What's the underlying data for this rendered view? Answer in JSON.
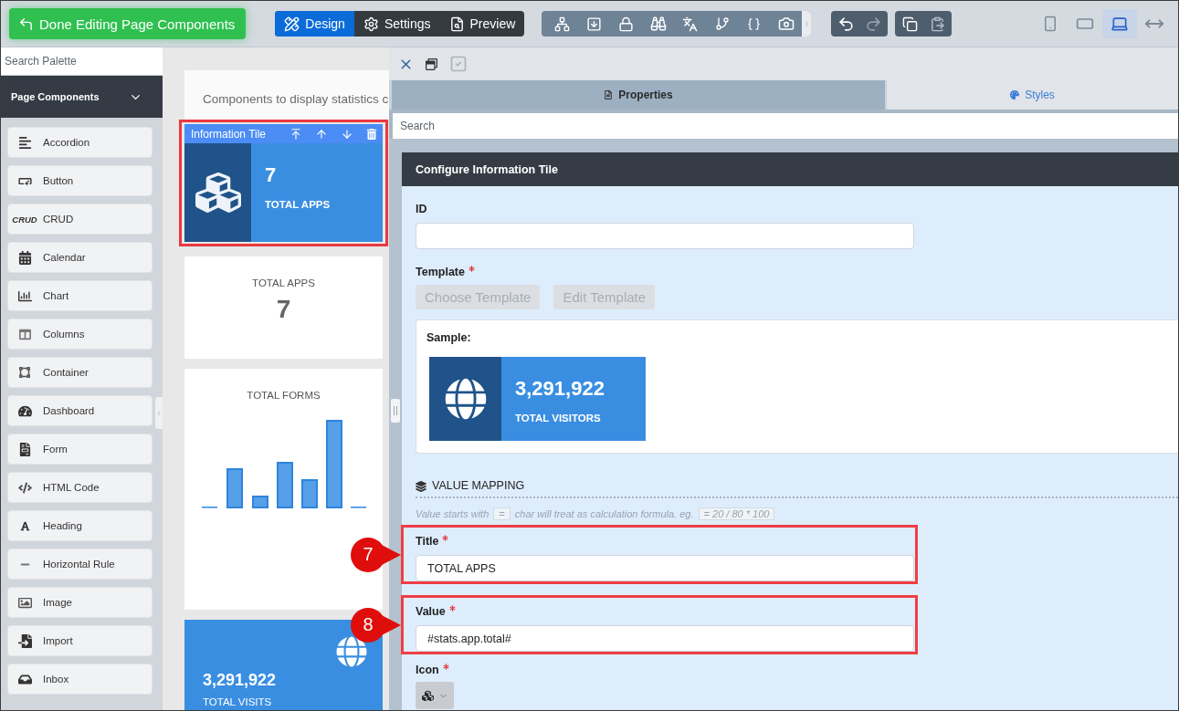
{
  "toolbar": {
    "done_button": "Done Editing Page Components",
    "modes": [
      {
        "kind": "design",
        "label": "Design",
        "selected": true
      },
      {
        "kind": "settings",
        "label": "Settings",
        "selected": false
      },
      {
        "kind": "preview",
        "label": "Preview",
        "selected": false
      }
    ],
    "undo": {
      "disabled": false
    },
    "redo": {
      "disabled": true
    },
    "devices": [
      {
        "kind": "phone",
        "selected": false
      },
      {
        "kind": "tablet",
        "selected": false
      },
      {
        "kind": "laptop",
        "selected": true
      },
      {
        "kind": "full-width",
        "selected": false
      }
    ]
  },
  "palette": {
    "search_placeholder": "Search Palette",
    "section": {
      "title": "Page Components",
      "expanded": true
    },
    "items": [
      {
        "kind": "accordion",
        "label": "Accordion"
      },
      {
        "kind": "button",
        "label": "Button"
      },
      {
        "kind": "crud",
        "badge": "CRUD",
        "label": "CRUD"
      },
      {
        "kind": "calendar",
        "label": "Calendar"
      },
      {
        "kind": "chart",
        "label": "Chart"
      },
      {
        "kind": "columns",
        "label": "Columns"
      },
      {
        "kind": "container",
        "label": "Container"
      },
      {
        "kind": "dashboard",
        "label": "Dashboard"
      },
      {
        "kind": "form",
        "label": "Form"
      },
      {
        "kind": "html",
        "label": "HTML Code"
      },
      {
        "kind": "heading",
        "label": "Heading"
      },
      {
        "kind": "rule",
        "label": "Horizontal Rule"
      },
      {
        "kind": "image",
        "label": "Image"
      },
      {
        "kind": "import",
        "label": "Import"
      },
      {
        "kind": "inbox",
        "label": "Inbox"
      }
    ]
  },
  "canvas": {
    "description": "Components to display statistics c",
    "tiles": [
      {
        "kind": "info",
        "label": "Information Tile",
        "selected": true,
        "value": "7",
        "title": "TOTAL APPS"
      },
      {
        "kind": "counter",
        "selected": false,
        "title": "TOTAL APPS",
        "value": "7"
      },
      {
        "kind": "chart",
        "selected": false,
        "title": "TOTAL FORMS"
      },
      {
        "kind": "visits",
        "selected": false,
        "value": "3,291,922",
        "title": "TOTAL VISITS"
      }
    ]
  },
  "panel": {
    "apply": {
      "disabled": true
    },
    "tabs": [
      {
        "kind": "properties",
        "label": "Properties",
        "selected": true
      },
      {
        "kind": "styles",
        "label": "Styles",
        "selected": false
      }
    ],
    "search_placeholder": "Search",
    "title": "Configure Information Tile",
    "id_field": {
      "label": "ID"
    },
    "template": {
      "label": "Template",
      "required": true,
      "buttons": [
        {
          "label": "Choose Template",
          "disabled": true
        },
        {
          "label": "Edit Template",
          "disabled": true
        }
      ]
    },
    "sample": {
      "label": "Sample:",
      "value": "3,291,922",
      "title": "TOTAL VISITORS"
    },
    "value_mapping": {
      "heading": "VALUE MAPPING",
      "hint": [
        {
          "kind": "text",
          "text": "Value starts with"
        },
        {
          "kind": "code",
          "text": "="
        },
        {
          "kind": "text",
          "text": "char will treat as calculation formula. eg."
        },
        {
          "kind": "code",
          "text": "= 20 / 80 * 100"
        }
      ],
      "fields": [
        {
          "label": "Title",
          "required": true,
          "value": "TOTAL APPS",
          "highlighted": true,
          "callout": "7"
        },
        {
          "label": "Value",
          "required": true,
          "value": "#stats.app.total#",
          "highlighted": true,
          "callout": "8"
        }
      ],
      "icon_field": {
        "label": "Icon",
        "required": true
      }
    }
  }
}
